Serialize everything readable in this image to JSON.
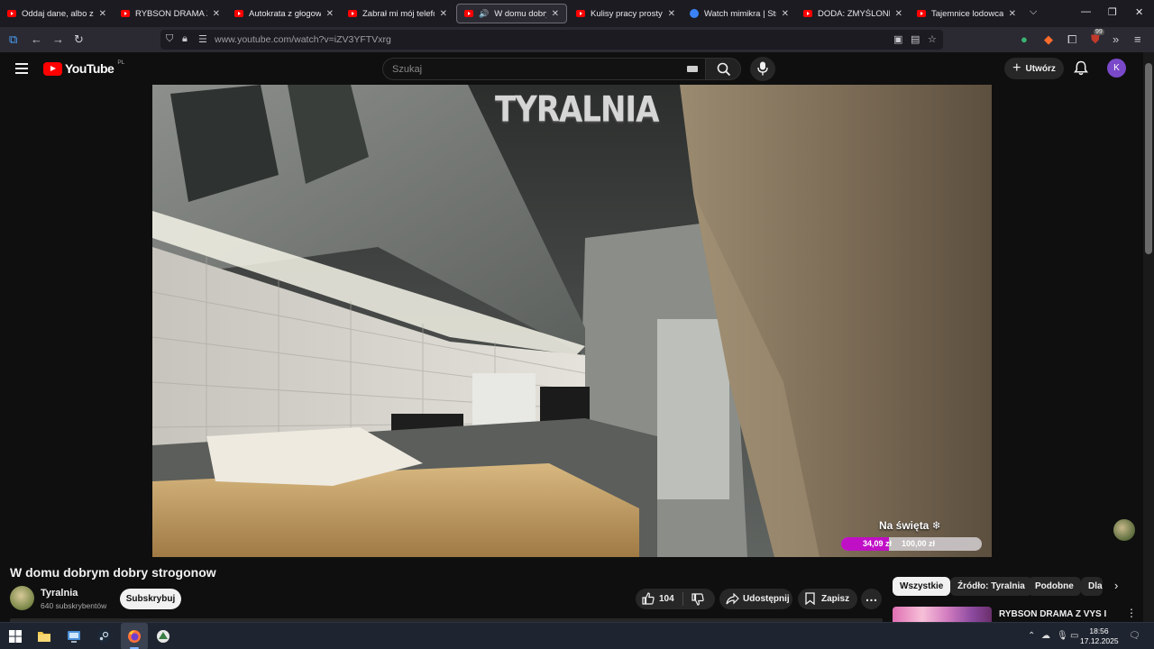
{
  "browser": {
    "tabs": [
      {
        "label": "Oddaj dane, albo zabiera",
        "active": false,
        "favicon": "youtube-icon"
      },
      {
        "label": "RYBSON DRAMA Z VYS I",
        "active": false,
        "favicon": "youtube-icon"
      },
      {
        "label": "Autokrata z głogowskiej",
        "active": false,
        "favicon": "youtube-icon"
      },
      {
        "label": "Zabrał mi mój telefon w",
        "active": false,
        "favicon": "youtube-icon"
      },
      {
        "label": "W domu dobrym do",
        "active": true,
        "favicon": "youtube-icon"
      },
      {
        "label": "Kulisy pracy prostytutki.",
        "active": false,
        "favicon": "youtube-icon"
      },
      {
        "label": "Watch mimikra | Stre",
        "active": false,
        "favicon": "globe-icon"
      },
      {
        "label": "DODA: ZMYŚLONE ŻYCIE",
        "active": false,
        "favicon": "youtube-icon"
      },
      {
        "label": "Tajemnice lodowca - You",
        "active": false,
        "favicon": "youtube-icon"
      }
    ],
    "url": "www.youtube.com/watch?v=iZV3YFTVxrg",
    "extension_badge": "99"
  },
  "youtube": {
    "logo_text": "YouTube",
    "region": "PL",
    "search_placeholder": "Szukaj",
    "create_label": "Utwórz",
    "avatar_letter": "K",
    "accent_color": "#ff0000"
  },
  "video": {
    "watermark": "TYRALNIA",
    "donation": {
      "title": "Na święta ❄",
      "current": "34,09 zł",
      "goal": "100,00 zł",
      "progress": 0.34
    },
    "title": "W domu dobrym dobry strogonow"
  },
  "channel": {
    "name": "Tyralnia",
    "subscribers": "640 subskrybentów",
    "subscribe_label": "Subskrybuj"
  },
  "actions": {
    "likes": "104",
    "share_label": "Udostępnij",
    "save_label": "Zapisz"
  },
  "filter_chips": [
    "Wszystkie",
    "Źródło: Tyralnia",
    "Podobne",
    "Dla"
  ],
  "recommendation": {
    "title": "RYBSON DRAMA Z VYS I REDAKCJA I WYBUCH"
  },
  "taskbar": {
    "time": "18:56",
    "date": "17.12.2025"
  }
}
